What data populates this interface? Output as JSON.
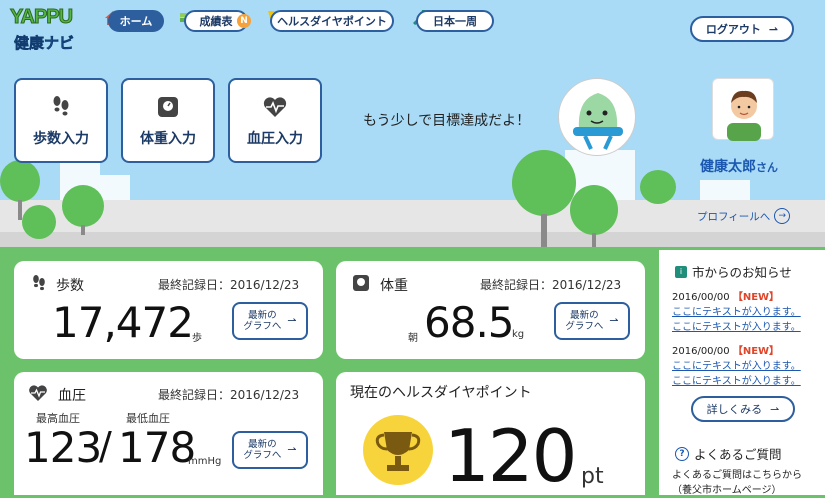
{
  "logo": {
    "line1": "YAPPU",
    "line2": "健康ナビ"
  },
  "nav": {
    "home": "ホーム",
    "grades": "成績表",
    "grades_badge": "N",
    "points": "ヘルスダイヤポイント",
    "tour": "日本一周",
    "logout": "ログアウト"
  },
  "entries": {
    "steps": "歩数入力",
    "weight": "体重入力",
    "bp": "血圧入力"
  },
  "message": "もう少しで目標達成だよ！",
  "user": {
    "name": "健康太郎",
    "suffix": "さん",
    "profile_link": "プロフィールへ"
  },
  "steps": {
    "title": "歩数",
    "date": "最終記録日：2016/12/23",
    "value": "17,472",
    "unit": "歩"
  },
  "weight": {
    "title": "体重",
    "date": "最終記録日：2016/12/23",
    "prefix": "朝",
    "value": "68.5",
    "unit": "kg"
  },
  "bp": {
    "title": "血圧",
    "date": "最終記録日：2016/12/23",
    "high_label": "最高血圧",
    "low_label": "最低血圧",
    "high": "123",
    "sep": "/",
    "low": "178",
    "unit": "mmHg"
  },
  "graph_btn": {
    "line1": "最新の",
    "line2": "グラフへ"
  },
  "points": {
    "title": "現在のヘルスダイヤポイント",
    "value": "120",
    "unit": "pt"
  },
  "news": {
    "title": "市からのお知らせ",
    "items": [
      {
        "date": "2016/00/00",
        "tag": "【NEW】",
        "line1": "ここにテキストが入ります。",
        "line2": "ここにテキストが入ります。"
      },
      {
        "date": "2016/00/00",
        "tag": "【NEW】",
        "line1": "ここにテキストが入ります。",
        "line2": "ここにテキストが入ります。"
      }
    ],
    "more": "詳しくみる"
  },
  "faq": {
    "title": "よくあるご質問",
    "line1": "よくあるご質問はこちらから",
    "line2": "（養父市ホームページ）"
  },
  "colors": {
    "nav_blue": "#2d5f9e",
    "sky": "#a9dbf6",
    "grass": "#6cc26a",
    "new_red": "#e0452a"
  }
}
